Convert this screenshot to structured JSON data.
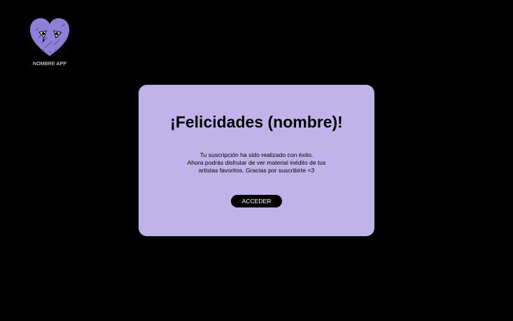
{
  "app": {
    "name": "NOMBRE APP",
    "logo_icon": "heart-face-icon"
  },
  "modal": {
    "title": "¡Felicidades (nombre)!",
    "message_lines": [
      "Tu suscripción ha sido realizado con éxito.",
      "Ahora podrás disfrutar de ver material inédito de tus",
      "artistas favoritos. Gracias por suscribirte <3"
    ],
    "button_label": "ACCEDER"
  },
  "colors": {
    "background": "#000000",
    "modal_background": "#c0b3ea",
    "logo_heart": "#8e7fd8",
    "button_background": "#000000",
    "button_text": "#ffffff"
  }
}
